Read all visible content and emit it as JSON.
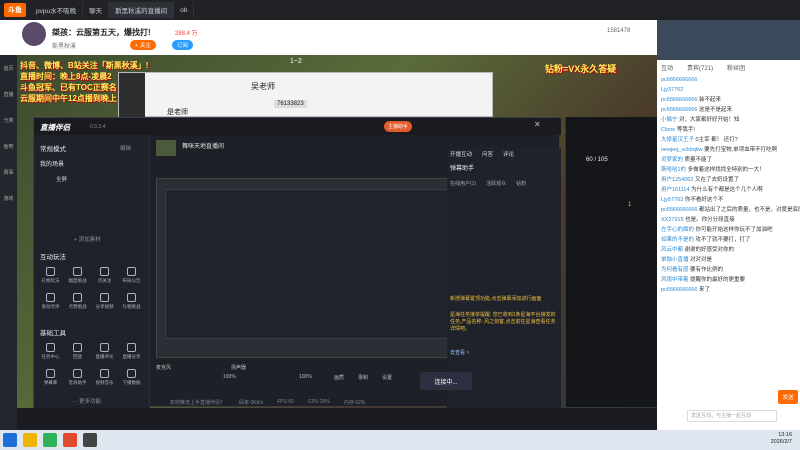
{
  "browser": {
    "tabs": [
      {
        "label": "pvpu水不吸晚"
      },
      {
        "label": "聊天"
      },
      {
        "label": "斗鱼"
      },
      {
        "label": "斯黑秋溪的直播间"
      },
      {
        "label": "ob"
      }
    ]
  },
  "header": {
    "room_title": "桀孩：云服第五天，爆找打!",
    "streamer_name": "斯黑秋溪",
    "heat": "288.4 万",
    "follow_label": "+ 关注",
    "sub_label": "订阅",
    "viewer_count": "1581478"
  },
  "left_nav": [
    {
      "label": "首页"
    },
    {
      "label": "直播"
    },
    {
      "label": "分类"
    },
    {
      "label": "鱼吧"
    },
    {
      "label": "赛事"
    },
    {
      "label": "游戏"
    }
  ],
  "stream": {
    "overlay_lines": [
      "抖音、微博、B站关注「斯黑秋溪」!",
      "直播时间：晚上8点-凌晨2",
      "斗鱼冠军、已有TOC正赛名",
      "云服期间中午12点播到晚上"
    ],
    "overlay_right": "钻粉=VX永久答疑",
    "score": "1~2"
  },
  "wechat": {
    "contact": "吴老师",
    "contact_sub": "是老师",
    "number": "76133823"
  },
  "obs": {
    "logo": "直播伴侣",
    "version": "0.3.3.4",
    "mode": "常规模式",
    "edit": "编辑",
    "scene_label": "我的场景",
    "scene_item": "全屏",
    "add_material": "+ 添加素材",
    "interact_title": "互动玩法",
    "basic_tools_title": "基础工具",
    "interact_tools": [
      "礼物玩法",
      "幅度挑战",
      "点关注",
      "布局公告",
      "发动点评",
      "点赞挑战",
      "分享视频",
      "礼物挑战"
    ],
    "basic_tools": [
      "任务中心",
      "回放",
      "直播评论",
      "直播分享",
      "弹幕库",
      "音效助手",
      "视频音乐",
      "下播数据"
    ],
    "more_tools": "··· 更多功能",
    "stream_name": "舞咪天地直播间",
    "status_badge": "主播助手",
    "tabs_right": [
      "开播互动",
      "问答",
      "评论"
    ],
    "danmu_title": "弹幕助手",
    "danmu_tabs": [
      "在线用户(1)",
      "活跃观众",
      "钻粉"
    ],
    "danmu_notice": "新增弹幕置顶功能,点击弹幕添加进行画面",
    "danmu_text": "星海任务接单提醒: 您已收到1条星海平台接发的任务,产品名称: 风之剑客,点击前往星海查看任务详情吧。",
    "danmu_link": "去查看 >",
    "bottom_labels": [
      "麦克风",
      "扬声器",
      "画质",
      "录制",
      "设置"
    ],
    "volume_1": "100%",
    "volume_2": "100%",
    "start_live": "连接中...",
    "status_items": [
      "如何推流上手直播伴侣？",
      "码率 0Kb/s",
      "FPS 60",
      "CPU 26%",
      "内存 62%"
    ]
  },
  "chat": {
    "tabs": [
      "互动",
      "贵宾(721)",
      "粉丝团"
    ],
    "lines": [
      {
        "user": "pc6666666666",
        "text": ""
      },
      {
        "user": "Ljy37762",
        "text": ""
      },
      {
        "user": "pc6666666666",
        "text": "装不起来"
      },
      {
        "user": "pc6666666666",
        "text": "这是不是起来"
      },
      {
        "user": "小猫宁",
        "text": "对，大家都好好开始！知"
      },
      {
        "user": "Clone",
        "text": "等我手!"
      },
      {
        "user": "大修星汉王子",
        "text": "0主宰 都！ 还打?"
      },
      {
        "user": "newjeq_vckbqitw",
        "text": "要先打宝物,单项血带不打吃啊"
      },
      {
        "user": "灵梦家的",
        "text": "质量不能了"
      },
      {
        "user": "斯哈哈1的",
        "text": "多做着这样找找全特别的一大！"
      },
      {
        "user": "用户1254062",
        "text": "又在了去奶设置了"
      },
      {
        "user": "用户161114",
        "text": "为什么有个都是这个几个人啊"
      },
      {
        "user": "Ljy57762",
        "text": "你不看好这个不"
      },
      {
        "user": "pc6666666666",
        "text": "都站出了之后的质量，也不是，对度是底的"
      },
      {
        "user": "XX27915",
        "text": "也是。你分分段直接"
      },
      {
        "user": "左手心的面的",
        "text": "你可能开始这样你玩不了加油吧"
      },
      {
        "user": "如果的不是的",
        "text": "攻不了就不要打，打了"
      },
      {
        "user": "风云中都",
        "text": "谢谢的好感受对你的"
      },
      {
        "user": "单独小直播",
        "text": "对对对是"
      },
      {
        "user": "为何看有感",
        "text": "要有作比例的"
      },
      {
        "user": "风雨中带着",
        "text": "提醒你的最好的更重要"
      },
      {
        "user": "pc6666666666",
        "text": "来了"
      }
    ],
    "input_placeholder": "发送互动，与主播一起互动",
    "send_label": "发送"
  },
  "hud": {
    "hp": "60 / 105",
    "gold": "1"
  },
  "taskbar": {
    "time": "13:16",
    "date": "2026/2/7"
  }
}
